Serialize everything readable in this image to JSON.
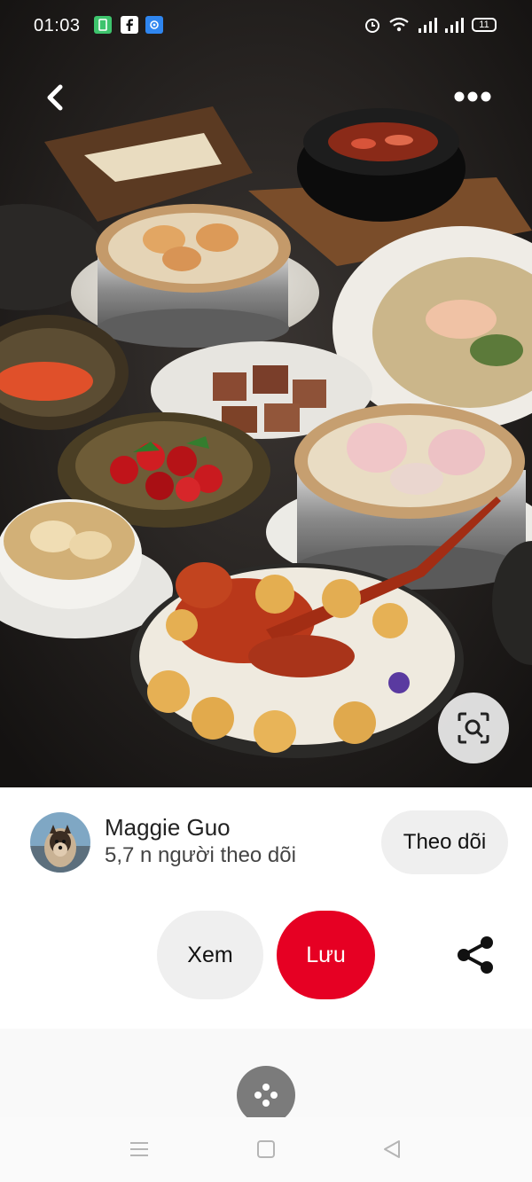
{
  "status_bar": {
    "time": "01:03",
    "battery": "11",
    "icons": [
      "sim-icon",
      "facebook-icon",
      "vpn-icon",
      "alarm-icon",
      "wifi-icon",
      "signal-icon",
      "signal-icon",
      "battery-icon"
    ]
  },
  "header": {
    "back_icon": "chevron-left-icon",
    "more_icon": "more-dots-icon"
  },
  "image": {
    "subject": "Chinese banquet spread with dim sum and lobster",
    "visual_search_icon": "lens-search-icon"
  },
  "author": {
    "name": "Maggie Guo",
    "followers": "5,7 n người theo dõi",
    "follow_label": "Theo dõi"
  },
  "actions": {
    "view_label": "Xem",
    "save_label": "Lưu",
    "share_icon": "share-icon"
  },
  "colors": {
    "save_red": "#e60023",
    "button_gray": "#efefef"
  },
  "nav": {
    "icons": [
      "menu-icon",
      "home-square-icon",
      "back-triangle-icon"
    ]
  }
}
